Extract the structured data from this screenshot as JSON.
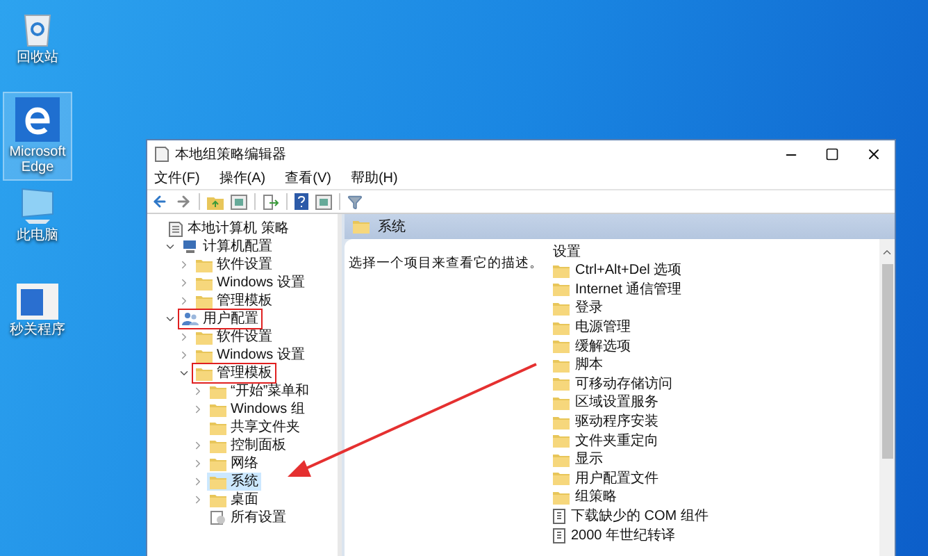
{
  "desktop_icons": [
    {
      "kind": "recycle",
      "label": "回收站",
      "selected": false
    },
    {
      "kind": "edge",
      "label": "Microsoft Edge",
      "selected": true
    },
    {
      "kind": "computer",
      "label": "此电脑",
      "selected": false
    },
    {
      "kind": "app",
      "label": "秒关程序",
      "selected": false
    }
  ],
  "window": {
    "title": "本地组策略编辑器"
  },
  "menu": [
    "文件(F)",
    "操作(A)",
    "查看(V)",
    "帮助(H)"
  ],
  "tree": [
    {
      "label": "本地计算机 策略",
      "kind": "policy",
      "selected": false,
      "boxed": false,
      "children": [
        {
          "label": "计算机配置",
          "kind": "computer",
          "expanded": true,
          "selected": false,
          "boxed": false,
          "children": [
            {
              "label": "软件设置",
              "kind": "folder",
              "expanded": false,
              "selected": false,
              "boxed": false
            },
            {
              "label": "Windows 设置",
              "kind": "folder",
              "expanded": false,
              "selected": false,
              "boxed": false
            },
            {
              "label": "管理模板",
              "kind": "folder",
              "expanded": false,
              "selected": false,
              "boxed": false
            }
          ]
        },
        {
          "label": "用户配置",
          "kind": "user",
          "expanded": true,
          "selected": false,
          "boxed": true,
          "children": [
            {
              "label": "软件设置",
              "kind": "folder",
              "expanded": false,
              "selected": false,
              "boxed": false
            },
            {
              "label": "Windows 设置",
              "kind": "folder",
              "expanded": false,
              "selected": false,
              "boxed": false
            },
            {
              "label": "管理模板",
              "kind": "folder",
              "expanded": true,
              "selected": false,
              "boxed": true,
              "children": [
                {
                  "label": "“开始”菜单和",
                  "kind": "folder",
                  "expanded": false,
                  "selected": false,
                  "boxed": false
                },
                {
                  "label": "Windows 组",
                  "kind": "folder",
                  "expanded": false,
                  "selected": false,
                  "boxed": false
                },
                {
                  "label": "共享文件夹",
                  "kind": "folder",
                  "selected": false,
                  "boxed": false
                },
                {
                  "label": "控制面板",
                  "kind": "folder",
                  "expanded": false,
                  "selected": false,
                  "boxed": false
                },
                {
                  "label": "网络",
                  "kind": "folder",
                  "expanded": false,
                  "selected": false,
                  "boxed": false
                },
                {
                  "label": "系统",
                  "kind": "folder",
                  "expanded": false,
                  "selected": true,
                  "boxed": false
                },
                {
                  "label": "桌面",
                  "kind": "folder",
                  "expanded": false,
                  "selected": false,
                  "boxed": false
                },
                {
                  "label": "所有设置",
                  "kind": "settings",
                  "selected": false,
                  "boxed": false
                }
              ]
            }
          ]
        }
      ]
    }
  ],
  "content": {
    "header": "系统",
    "description": "选择一个项目来查看它的描述。",
    "column_heading": "设置",
    "items": [
      {
        "kind": "folder",
        "label": "Ctrl+Alt+Del 选项"
      },
      {
        "kind": "folder",
        "label": "Internet 通信管理"
      },
      {
        "kind": "folder",
        "label": "登录"
      },
      {
        "kind": "folder",
        "label": "电源管理"
      },
      {
        "kind": "folder",
        "label": "缓解选项"
      },
      {
        "kind": "folder",
        "label": "脚本"
      },
      {
        "kind": "folder",
        "label": "可移动存储访问"
      },
      {
        "kind": "folder",
        "label": "区域设置服务"
      },
      {
        "kind": "folder",
        "label": "驱动程序安装"
      },
      {
        "kind": "folder",
        "label": "文件夹重定向"
      },
      {
        "kind": "folder",
        "label": "显示"
      },
      {
        "kind": "folder",
        "label": "用户配置文件"
      },
      {
        "kind": "folder",
        "label": "组策略"
      },
      {
        "kind": "setting",
        "label": "下载缺少的 COM 组件"
      },
      {
        "kind": "setting",
        "label": "2000 年世纪转译"
      }
    ]
  }
}
